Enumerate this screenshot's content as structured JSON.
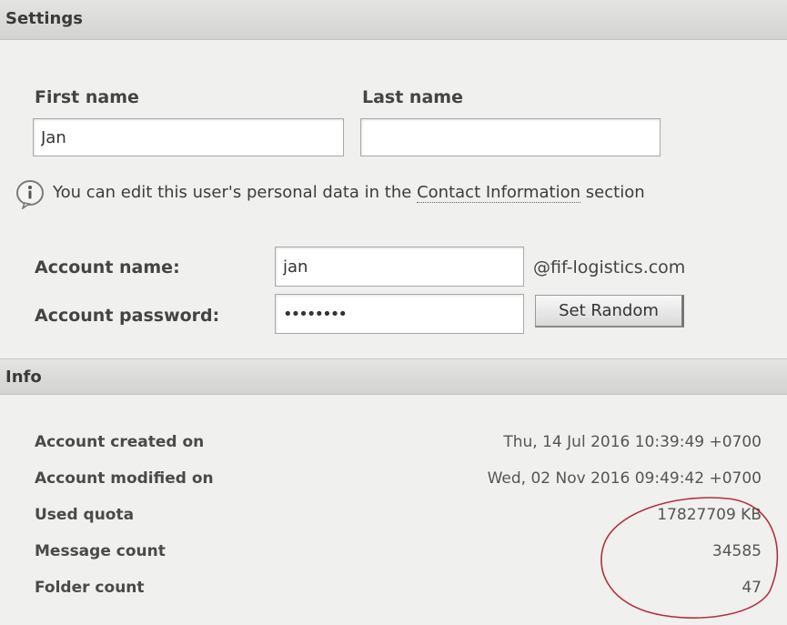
{
  "settings": {
    "title": "Settings",
    "first_name_label": "First name",
    "first_name_value": "Jan",
    "last_name_label": "Last name",
    "last_name_value": "",
    "info_message": "You can edit this user's personal data in the",
    "info_link": "Contact Information",
    "info_suffix": "section",
    "account_name_label": "Account name:",
    "account_name_value": "jan",
    "domain": "@fif-logistics.com",
    "account_password_label": "Account password:",
    "account_password_value": "••••••••",
    "set_random_label": "Set Random"
  },
  "info": {
    "title": "Info",
    "rows": [
      {
        "label": "Account created on",
        "value": "Thu, 14 Jul 2016 10:39:49 +0700"
      },
      {
        "label": "Account modified on",
        "value": "Wed, 02 Nov 2016 09:49:42 +0700"
      },
      {
        "label": "Used quota",
        "value": "17827709 KB"
      },
      {
        "label": "Message count",
        "value": "34585"
      },
      {
        "label": "Folder count",
        "value": "47"
      }
    ]
  },
  "annotation": {
    "icon": "red-ellipse-annotation",
    "color": "#b0323c"
  }
}
